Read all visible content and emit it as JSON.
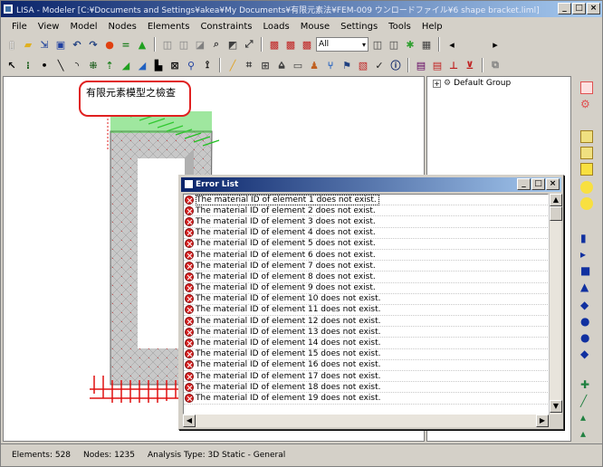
{
  "window": {
    "title": "LISA - Modeler [C:¥Documents and Settings¥akea¥My Documents¥有限元素法¥FEM-009 ウンロードファイル¥6 shape bracket.liml]",
    "min": "_",
    "max": "□",
    "close": "×"
  },
  "menu": [
    "File",
    "View",
    "Model",
    "Nodes",
    "Elements",
    "Constraints",
    "Loads",
    "Mouse",
    "Settings",
    "Tools",
    "Help"
  ],
  "toolbar": {
    "combo_value": "All",
    "row1_icons": [
      "new-icon",
      "open-icon",
      "import-icon",
      "save-icon",
      "undo-icon",
      "redo-icon",
      "check-icon",
      "equals-icon",
      "triangle-icon"
    ],
    "row2_icons": [
      "select-icon",
      "node-icon",
      "line-icon"
    ]
  },
  "callout": {
    "text": "有限元素模型之檢查"
  },
  "tree": {
    "root": "Default Group"
  },
  "error_dialog": {
    "title": "Error List",
    "rows": [
      "The material ID of element 1 does not exist.",
      "The material ID of element 2 does not exist.",
      "The material ID of element 3 does not exist.",
      "The material ID of element 4 does not exist.",
      "The material ID of element 5 does not exist.",
      "The material ID of element 6 does not exist.",
      "The material ID of element 7 does not exist.",
      "The material ID of element 8 does not exist.",
      "The material ID of element 9 does not exist.",
      "The material ID of element 10 does not exist.",
      "The material ID of element 11 does not exist.",
      "The material ID of element 12 does not exist.",
      "The material ID of element 13 does not exist.",
      "The material ID of element 14 does not exist.",
      "The material ID of element 15 does not exist.",
      "The material ID of element 16 does not exist.",
      "The material ID of element 17 does not exist.",
      "The material ID of element 18 does not exist.",
      "The material ID of element 19 does not exist."
    ]
  },
  "status": {
    "elements": "Elements: 528",
    "nodes": "Nodes: 1235",
    "analysis": "Analysis Type: 3D Static - General"
  },
  "colors": {
    "title_start": "#0a246a",
    "title_end": "#a6caf0",
    "error_red": "#d82020",
    "callout_border": "#e02020",
    "mesh_gray": "#c0c0c0"
  }
}
